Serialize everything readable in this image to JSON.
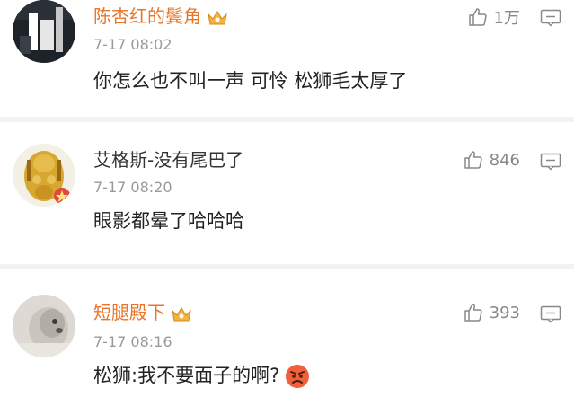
{
  "comments": [
    {
      "user": "陈杏红的鬓角",
      "time": "7-17 08:02",
      "text": "你怎么也不叫一声 可怜 松狮毛太厚了",
      "likes": "1万"
    },
    {
      "user": "艾格斯-没有尾巴了",
      "time": "7-17 08:20",
      "text": "眼影都晕了哈哈哈",
      "likes": "846"
    },
    {
      "user": "短腿殿下",
      "time": "7-17 08:16",
      "text": "松狮:我不要面子的啊?",
      "likes": "393"
    }
  ],
  "colors": {
    "vip_name": "#e8752a",
    "plain_name": "#333333",
    "meta": "#999999",
    "divider": "#f2f2f2"
  },
  "icons": {
    "like": "thumbs-up-icon",
    "reply": "comment-icon",
    "crown": "crown-icon",
    "emoji": "angry-face-icon"
  }
}
